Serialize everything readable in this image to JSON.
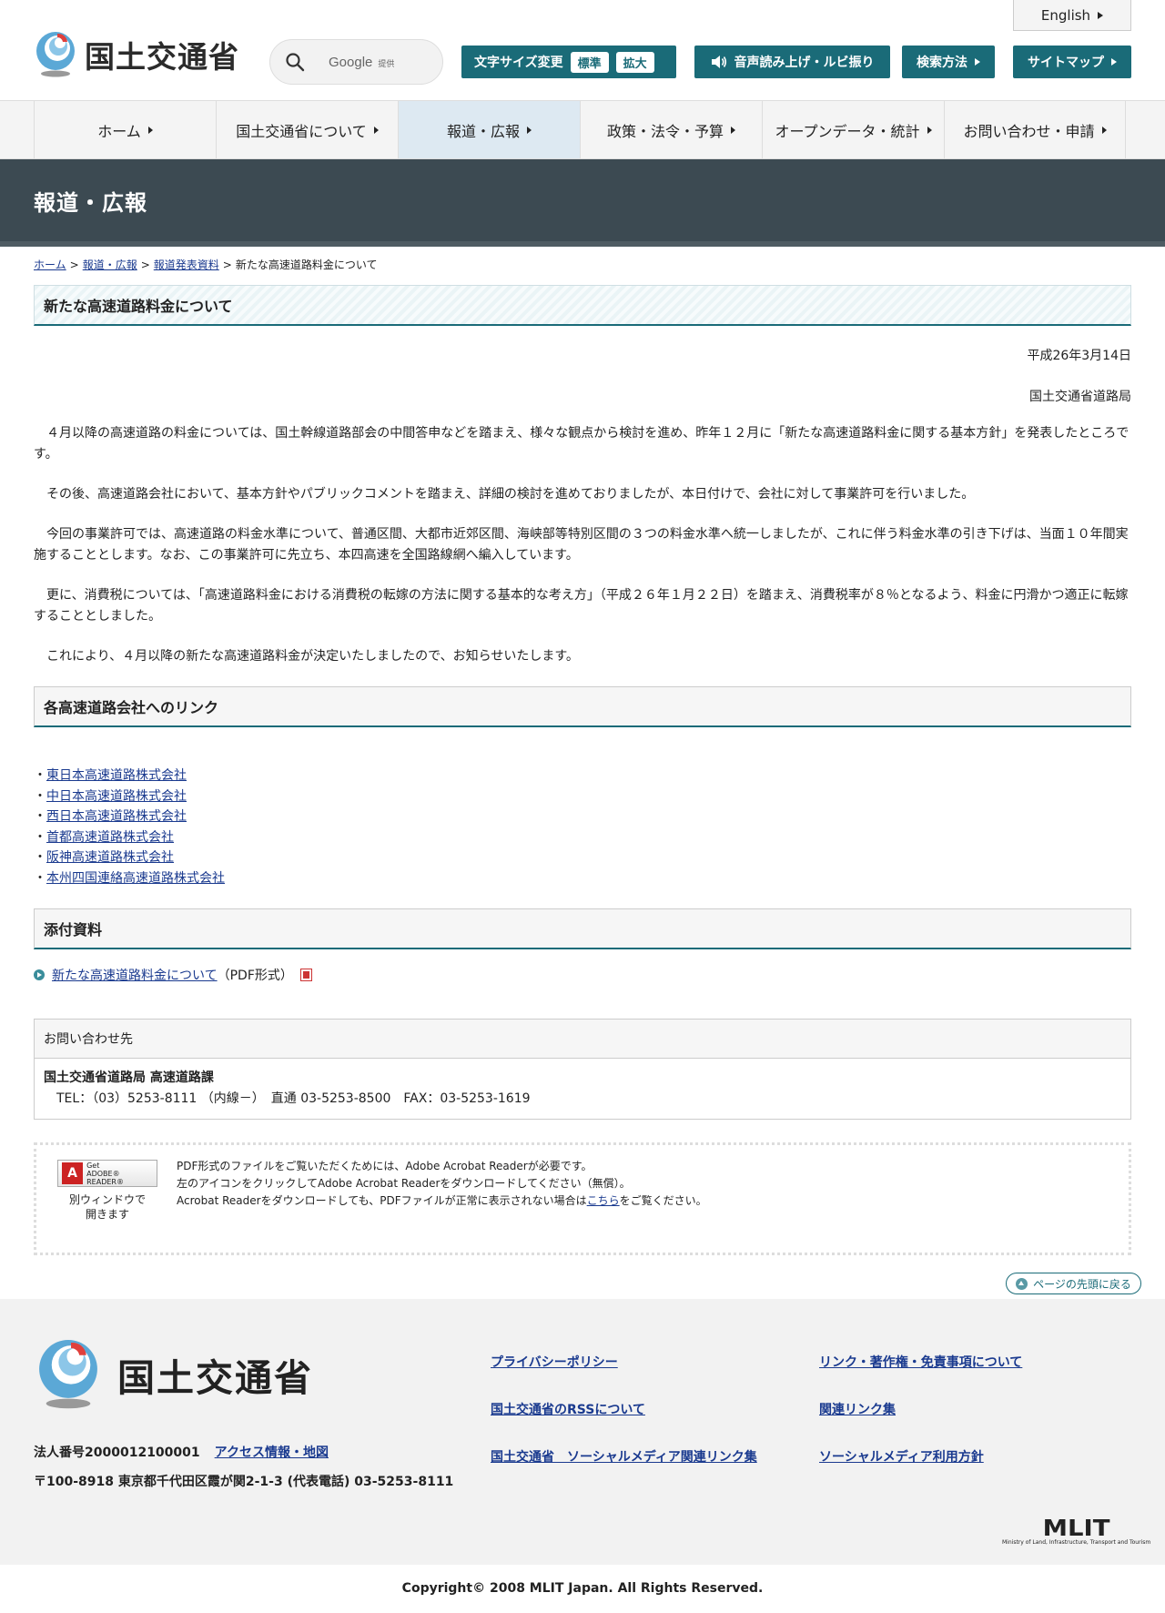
{
  "header": {
    "logo_text": "国土交通省",
    "english_label": "English",
    "search": {
      "label": "Google",
      "sub": "提供"
    },
    "fontsize": {
      "label": "文字サイズ変更",
      "standard": "標準",
      "large": "拡大"
    },
    "voice_label": "音声読み上げ・ルビ振り",
    "howto_label": "検索方法",
    "sitemap_label": "サイトマップ"
  },
  "nav": {
    "items": [
      {
        "label": "ホーム"
      },
      {
        "label": "国土交通省について"
      },
      {
        "label": "報道・広報"
      },
      {
        "label": "政策・法令・予算"
      },
      {
        "label": "オープンデータ・統計"
      },
      {
        "label": "お問い合わせ・申請"
      }
    ]
  },
  "page": {
    "band_title": "報道・広報",
    "breadcrumb": [
      "ホーム",
      "報道・広報",
      "報道発表資料",
      "新たな高速道路料金について"
    ],
    "title": "新たな高速道路料金について",
    "date": "平成26年3月14日",
    "department": "国土交通省道路局",
    "paragraphs": [
      "４月以降の高速道路の料金については、国土幹線道路部会の中間答申などを踏まえ、様々な観点から検討を進め、昨年１２月に「新たな高速道路料金に関する基本方針」を発表したところです。",
      "その後、高速道路会社において、基本方針やパブリックコメントを踏まえ、詳細の検討を進めておりましたが、本日付けで、会社に対して事業許可を行いました。",
      "今回の事業許可では、高速道路の料金水準について、普通区間、大都市近郊区間、海峡部等特別区間の３つの料金水準へ統一しましたが、これに伴う料金水準の引き下げは、当面１０年間実施することとします。なお、この事業許可に先立ち、本四高速を全国路線網へ編入しています。",
      "更に、消費税については、「高速道路料金における消費税の転嫁の方法に関する基本的な考え方」（平成２６年１月２２日）を踏まえ、消費税率が８％となるよう、料金に円滑かつ適正に転嫁することとしました。",
      "これにより、４月以降の新たな高速道路料金が決定いたしましたので、お知らせいたします。"
    ],
    "links_heading": "各高速道路会社へのリンク",
    "company_links": [
      "東日本高速道路株式会社",
      "中日本高速道路株式会社",
      "西日本高速道路株式会社",
      "首都高速道路株式会社",
      "阪神高速道路株式会社",
      "本州四国連絡高速道路株式会社"
    ],
    "attachments_heading": "添付資料",
    "attachment": {
      "link": "新たな高速道路料金について",
      "format": "（PDF形式）"
    },
    "inquiry": {
      "heading": "お問い合わせ先",
      "org": "国土交通省道路局 高速道路課",
      "tel": "TEL：（03）5253-8111 （内線－）　直通 03-5253-8500　FAX：03-5253-1619"
    },
    "adobe": {
      "badge_get": "Get",
      "badge_name": "ADOBE® READER®",
      "caption_line1": "別ウィンドウで",
      "caption_line2": "開きます",
      "line1": "PDF形式のファイルをご覧いただくためには、Adobe Acrobat Readerが必要です。",
      "line2": "左のアイコンをクリックしてAdobe Acrobat Readerをダウンロードしてください（無償）。",
      "line3_before": "Acrobat Readerをダウンロードしても、PDFファイルが正常に表示されない場合は",
      "line3_link": "こちら",
      "line3_after": "をご覧ください。"
    },
    "pagetop_label": "ページの先頭に戻る"
  },
  "footer": {
    "logo_text": "国土交通省",
    "corp_number": "法人番号2000012100001",
    "access_link": "アクセス情報・地図",
    "address": "〒100-8918 東京都千代田区霞が関2-1-3 (代表電話) 03-5253-8111",
    "links": [
      "プライバシーポリシー",
      "リンク・著作権・免責事項について",
      "国土交通省のRSSについて",
      "関連リンク集",
      "国土交通省　ソーシャルメディア関連リンク集",
      "ソーシャルメディア利用方針"
    ],
    "mlit_logo": "MLIT",
    "mlit_sub": "Ministry of Land, Infrastructure, Transport and Tourism",
    "copyright": "Copyright© 2008 MLIT Japan. All Rights Reserved."
  },
  "colors": {
    "teal": "#1a6b78",
    "band": "#3c4a52",
    "link": "#1a3a8f",
    "nav_active": "#dde9f2"
  }
}
